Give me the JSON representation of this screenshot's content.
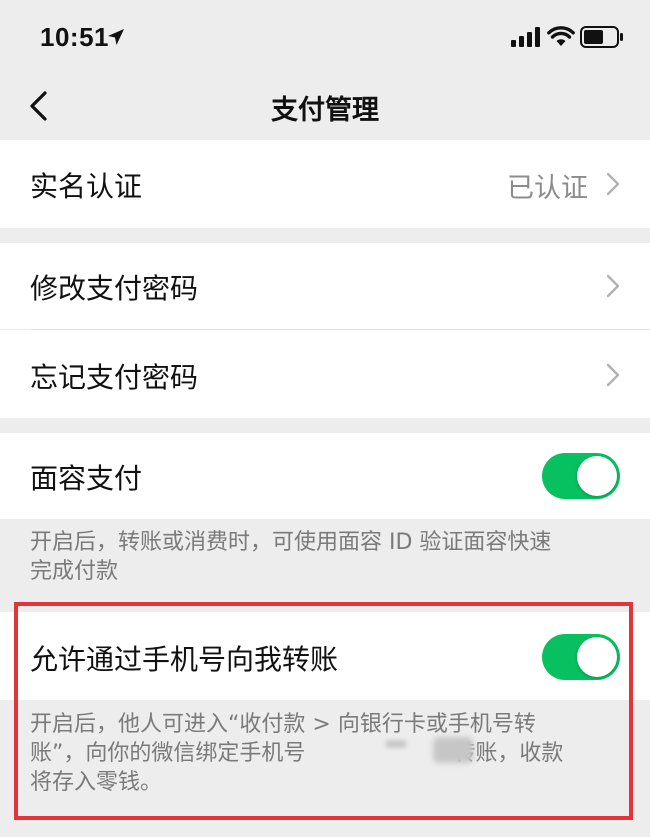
{
  "status_bar": {
    "time": "10:51",
    "icons": [
      "location-arrow-icon",
      "cellular-signal-icon",
      "wifi-icon",
      "battery-icon"
    ]
  },
  "nav": {
    "title": "支付管理",
    "back_icon": "chevron-left-icon"
  },
  "rows": {
    "realname": {
      "label": "实名认证",
      "value": "已认证"
    },
    "change_pwd": {
      "label": "修改支付密码"
    },
    "forgot_pwd": {
      "label": "忘记支付密码"
    },
    "face_pay": {
      "label": "面容支付",
      "enabled": true,
      "desc_line1": "开启后，转账或消费时，可使用面容 ID 验证面容快速",
      "desc_line2": "完成付款"
    },
    "phone_transfer": {
      "label": "允许通过手机号向我转账",
      "enabled": true,
      "desc_line1": "开启后，他人可进入“收付款 > 向银行卡或手机号转",
      "desc_line2a": "账”，向你的微信绑定手机号",
      "desc_line2b": "转账，收款",
      "desc_line3": "将存入零钱。"
    }
  },
  "colors": {
    "toggle_on": "#07c160",
    "highlight": "#e3343a",
    "background": "#ededed"
  }
}
